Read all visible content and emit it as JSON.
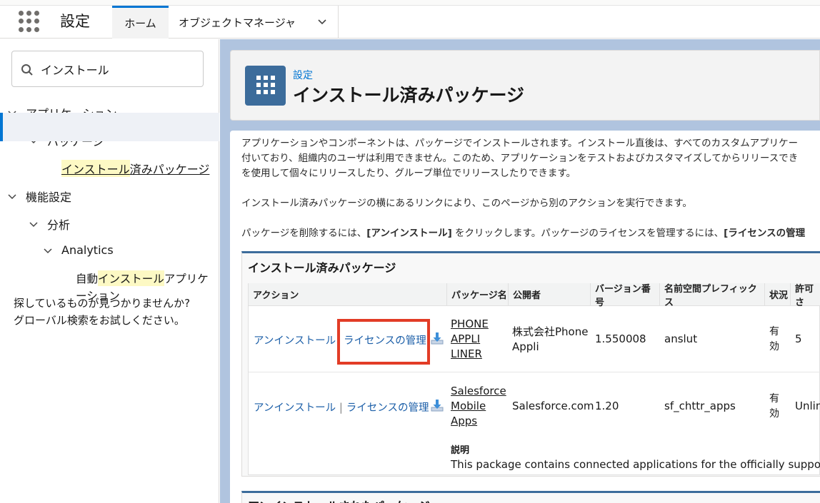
{
  "header": {
    "app_name": "設定",
    "tabs": [
      {
        "label": "ホーム"
      },
      {
        "label": "オブジェクトマネージャ"
      }
    ]
  },
  "sidebar": {
    "search_value": "インストール",
    "tree": {
      "applications": "アプリケーション",
      "packages": "パッケージ",
      "installed_hl": "インストール",
      "installed_rest": "済みパッケージ",
      "feature_settings": "機能設定",
      "analysis": "分析",
      "analytics": "Analytics",
      "auto_prefix": "自動",
      "auto_hl": "インストール",
      "auto_suffix": "アプリケ",
      "auto_line2": "ーション"
    },
    "help_line1": "探しているものが見つかりませんか?",
    "help_line2": "グローバル検索をお試しください。"
  },
  "page_header": {
    "breadcrumb": "設定",
    "title": "インストール済みパッケージ"
  },
  "intro": {
    "line1": "アプリケーションやコンポーネントは、パッケージでインストールされます。インストール直後は、すべてのカスタムアプリケー",
    "line2": "付いており、組織内のユーザは利用できません。このため、アプリケーションをテストおよびカスタマイズしてからリリースでき",
    "line3": "を使用して個々にリリースしたり、グループ単位でリリースしたりできます。",
    "para2": "インストール済みパッケージの横にあるリンクにより、このページから別のアクションを実行できます。",
    "para3_a": "パッケージを削除するには、",
    "para3_b": "[アンインストール]",
    "para3_c": " をクリックします。パッケージのライセンスを管理するには、",
    "para3_d": "[ライセンスの管理"
  },
  "installed_panel": {
    "title": "インストール済みパッケージ",
    "columns": [
      "アクション",
      "パッケージ名",
      "公開者",
      "バージョン番号",
      "名前空間プレフィックス",
      "状況",
      "許可さ"
    ],
    "rows": [
      {
        "uninstall": "アンインストール",
        "sep": "|",
        "manage": "ライセンスの管理",
        "name_l1": "PHONE",
        "name_l2": "APPLI",
        "name_l3": "LINER",
        "publisher_l1": "株式会社Phone",
        "publisher_l2": "Appli",
        "version": "1.550008",
        "namespace": "anslut",
        "status_l1": "有",
        "status_l2": "効",
        "allowed": "5"
      },
      {
        "uninstall": "アンインストール",
        "sep": "|",
        "manage": "ライセンスの管理",
        "name_l1": "Salesforce",
        "name_l2": "Mobile",
        "name_l3": "Apps",
        "publisher": "Salesforce.com",
        "version": "1.20",
        "namespace": "sf_chttr_apps",
        "status_l1": "有",
        "status_l2": "効",
        "allowed": "Unlim",
        "desc_label": "説明",
        "desc_text": "This package contains connected applications for the officially supported S"
      }
    ]
  },
  "uninstalled_panel": {
    "title": "アンインストールされたパッケージ"
  },
  "colors": {
    "brand_blue": "#0176d3",
    "link_blue": "#1c5fa8",
    "panel_blue": "#3c6c9b",
    "highlight": "#e23c26"
  }
}
